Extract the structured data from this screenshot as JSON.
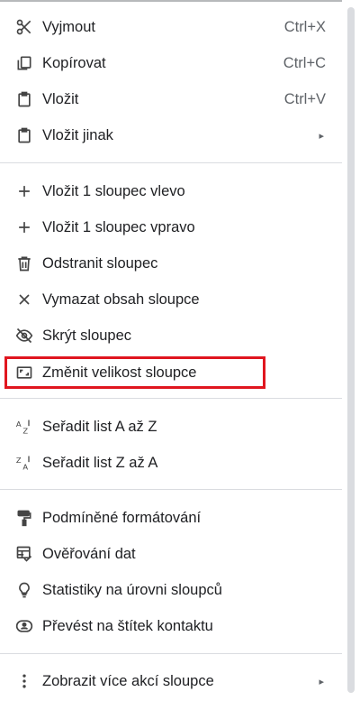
{
  "menu": {
    "items": [
      {
        "label": "Vyjmout",
        "shortcut": "Ctrl+X",
        "icon": "scissors-icon"
      },
      {
        "label": "Kopírovat",
        "shortcut": "Ctrl+C",
        "icon": "copy-icon"
      },
      {
        "label": "Vložit",
        "shortcut": "Ctrl+V",
        "icon": "clipboard-icon"
      },
      {
        "label": "Vložit jinak",
        "submenu": "▸",
        "icon": "clipboard-icon"
      },
      {
        "label": "Vložit 1 sloupec vlevo",
        "icon": "plus-icon"
      },
      {
        "label": "Vložit 1 sloupec vpravo",
        "icon": "plus-icon"
      },
      {
        "label": "Odstranit sloupec",
        "icon": "trash-icon"
      },
      {
        "label": "Vymazat obsah sloupce",
        "icon": "close-icon"
      },
      {
        "label": "Skrýt sloupec",
        "icon": "eye-off-icon"
      },
      {
        "label": "Změnit velikost sloupce",
        "icon": "resize-icon"
      },
      {
        "label": "Seřadit list A až Z",
        "icon": "sort-az-icon"
      },
      {
        "label": "Seřadit list Z až A",
        "icon": "sort-za-icon"
      },
      {
        "label": "Podmíněné formátování",
        "icon": "paint-roller-icon"
      },
      {
        "label": "Ověřování dat",
        "icon": "data-validation-icon"
      },
      {
        "label": "Statistiky na úrovni sloupců",
        "icon": "lightbulb-icon"
      },
      {
        "label": "Převést na štítek kontaktu",
        "icon": "contact-chip-icon"
      },
      {
        "label": "Zobrazit více akcí sloupce",
        "submenu": "▸",
        "icon": "more-vert-icon"
      }
    ]
  },
  "colors": {
    "highlight": "#e0161f",
    "text": "#202124",
    "muted": "#5f6368",
    "separator": "#dadce0"
  }
}
